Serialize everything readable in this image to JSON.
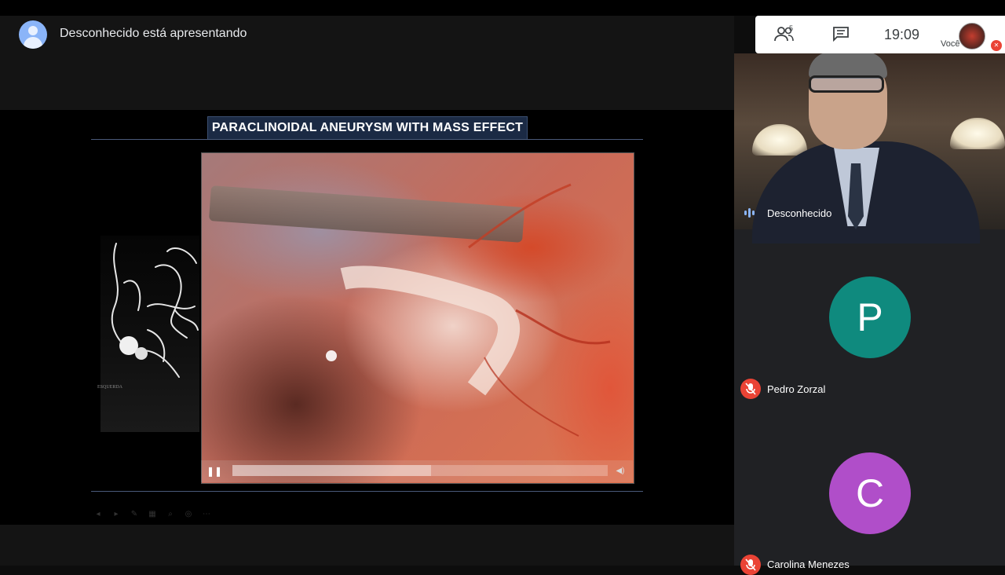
{
  "presenting_banner": {
    "text": "Desconhecido está apresentando"
  },
  "slide": {
    "title": "PARACLINOIDAL ANEURYSM WITH MASS EFFECT",
    "angio_caption": "ESQUERDA",
    "video_progress": 0.53
  },
  "header": {
    "participant_count": "5",
    "time": "19:09",
    "self_label": "Você"
  },
  "participants": [
    {
      "name": "Desconhecido",
      "speaking": true
    },
    {
      "name": "Pedro Zorzal",
      "initial": "P",
      "color": "#0f8a7e",
      "muted": true
    },
    {
      "name": "Carolina Menezes",
      "initial": "C",
      "color": "#b04ec9",
      "muted": true
    }
  ],
  "colors": {
    "mic_off": "#ea4335",
    "speaking": "#8ab4f8",
    "slide_title_bg": "#1b2a44"
  }
}
